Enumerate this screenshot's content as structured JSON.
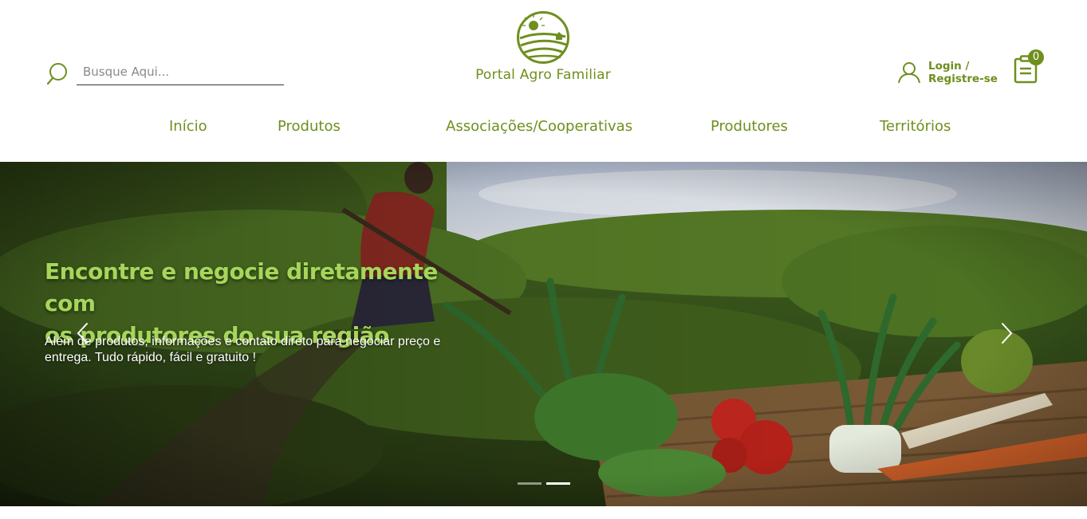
{
  "search": {
    "placeholder": "Busque Aqui..."
  },
  "brand": {
    "name": "Portal Agro Familiar"
  },
  "account": {
    "label_line1": "Login /",
    "label_line2": "Registre-se"
  },
  "cart": {
    "count": "0"
  },
  "nav": {
    "items": [
      {
        "label": "Início"
      },
      {
        "label": "Produtos"
      },
      {
        "label": "Associações/Cooperativas"
      },
      {
        "label": "Produtores"
      },
      {
        "label": "Territórios"
      }
    ]
  },
  "hero": {
    "headline_line1": "Encontre e negocie diretamente com",
    "headline_line2": "os produtores do sua região",
    "subtext_line1": "Além de produtos, informações e contato direto  para negociar preço e",
    "subtext_line2": "entrega. Tudo rápido, fácil e gratuito !",
    "slides": {
      "total": 2,
      "active": 2
    }
  },
  "colors": {
    "brand_green": "#6f8f1e",
    "headline_green": "#a6d65a"
  },
  "icons": [
    "search-icon",
    "user-icon",
    "clipboard-icon",
    "chevron-left-icon",
    "chevron-right-icon"
  ]
}
